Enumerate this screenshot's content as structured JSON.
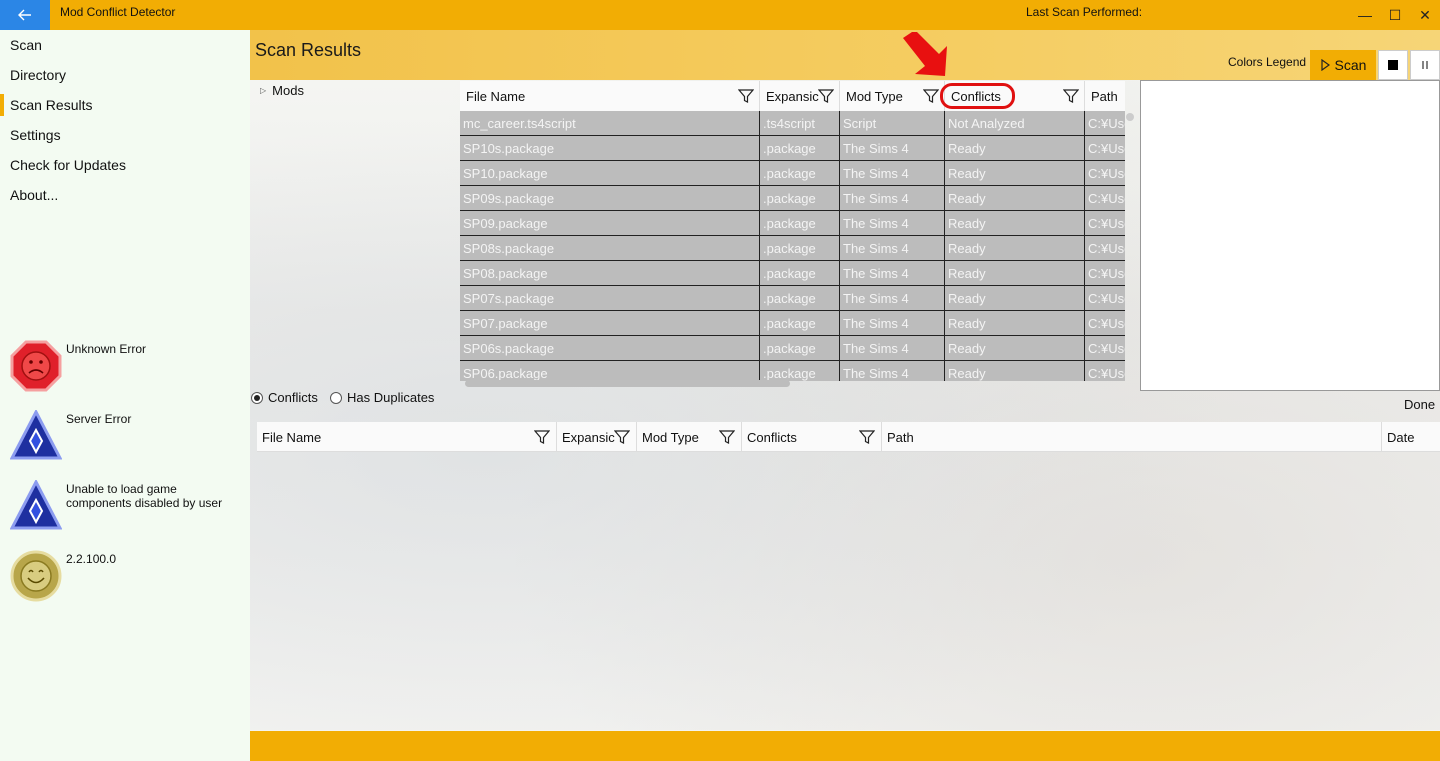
{
  "titlebar": {
    "back_icon": "arrow-left-icon",
    "app_title": "Mod Conflict Detector",
    "last_scan_label": "Last Scan Performed:",
    "minimize": "—",
    "maximize": "☐",
    "close": "✕"
  },
  "sidebar": {
    "items": [
      {
        "label": "Scan"
      },
      {
        "label": "Directory"
      },
      {
        "label": "Scan Results",
        "active": true
      },
      {
        "label": "Settings"
      },
      {
        "label": "Check for Updates"
      },
      {
        "label": "About..."
      }
    ],
    "statuses": [
      {
        "icon": "sad-face-error-icon",
        "label": "Unknown Error",
        "color": "#e0202a"
      },
      {
        "icon": "blue-diamond-icon",
        "label": "Server Error",
        "color": "#1e2fa0"
      },
      {
        "icon": "blue-diamond-icon",
        "label": "Unable to load game components disabled by user",
        "color": "#1e2fa0"
      },
      {
        "icon": "smiley-face-icon",
        "label": "2.2.100.0",
        "color": "#b8a64a"
      }
    ]
  },
  "main": {
    "page_title": "Scan Results",
    "colors_legend": "Colors Legend",
    "scan_button": "Scan",
    "scan_icon": "play-icon",
    "stop_icon": "stop-icon",
    "pause_icon": "pause-icon",
    "tree_root": "Mods",
    "top_grid": {
      "columns": [
        "File Name",
        "Expansic",
        "Mod Type",
        "Conflicts",
        "Path"
      ],
      "rows": [
        [
          "mc_career.ts4script",
          ".ts4script",
          "Script",
          "Not Analyzed",
          "C:¥Use"
        ],
        [
          "SP10s.package",
          ".package",
          "The Sims 4",
          "Ready",
          "C:¥Use"
        ],
        [
          "SP10.package",
          ".package",
          "The Sims 4",
          "Ready",
          "C:¥Use"
        ],
        [
          "SP09s.package",
          ".package",
          "The Sims 4",
          "Ready",
          "C:¥Use"
        ],
        [
          "SP09.package",
          ".package",
          "The Sims 4",
          "Ready",
          "C:¥Use"
        ],
        [
          "SP08s.package",
          ".package",
          "The Sims 4",
          "Ready",
          "C:¥Use"
        ],
        [
          "SP08.package",
          ".package",
          "The Sims 4",
          "Ready",
          "C:¥Use"
        ],
        [
          "SP07s.package",
          ".package",
          "The Sims 4",
          "Ready",
          "C:¥Use"
        ],
        [
          "SP07.package",
          ".package",
          "The Sims 4",
          "Ready",
          "C:¥Use"
        ],
        [
          "SP06s.package",
          ".package",
          "The Sims 4",
          "Ready",
          "C:¥Use"
        ],
        [
          "SP06.package",
          ".package",
          "The Sims 4",
          "Ready",
          "C:¥Use"
        ]
      ]
    },
    "radios": [
      {
        "label": "Conflicts",
        "checked": true
      },
      {
        "label": "Has Duplicates",
        "checked": false
      }
    ],
    "done_label": "Done",
    "bottom_grid": {
      "columns": [
        "File Name",
        "Expansic",
        "Mod Type",
        "Conflicts",
        "Path",
        "Date"
      ]
    }
  },
  "colors": {
    "accent": "#f2ad04",
    "back_button": "#2b86e6",
    "highlight": "#e01010"
  }
}
